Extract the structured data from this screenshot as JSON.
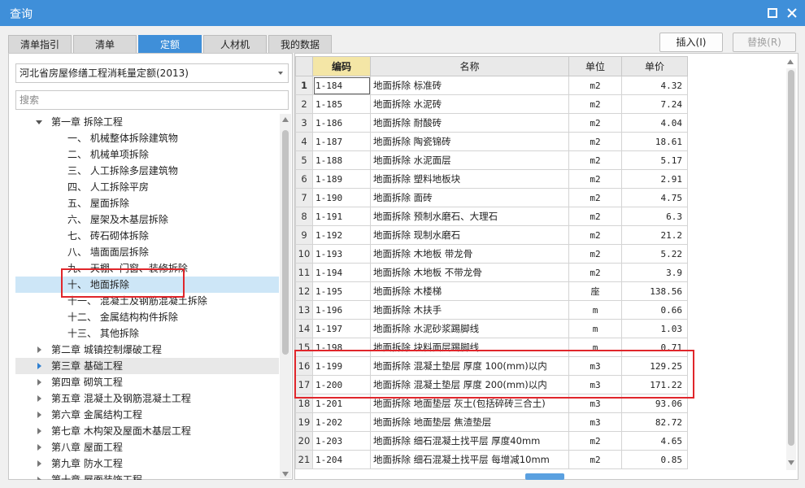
{
  "window": {
    "title": "查询"
  },
  "tabs": [
    {
      "label": "清单指引",
      "active": false
    },
    {
      "label": "清单",
      "active": false
    },
    {
      "label": "定额",
      "active": true
    },
    {
      "label": "人材机",
      "active": false
    },
    {
      "label": "我的数据",
      "active": false
    }
  ],
  "actions": {
    "insert_label": "插入(I)",
    "replace_label": "替换(R)"
  },
  "left": {
    "quota_db": "河北省房屋修缮工程消耗量定额(2013)",
    "search_placeholder": "搜索",
    "tree": [
      {
        "label": "第一章 拆除工程",
        "level": 1,
        "toggle": "down",
        "state": ""
      },
      {
        "label": "一、 机械整体拆除建筑物",
        "level": 2,
        "toggle": "",
        "state": ""
      },
      {
        "label": "二、 机械单项拆除",
        "level": 2,
        "toggle": "",
        "state": ""
      },
      {
        "label": "三、 人工拆除多层建筑物",
        "level": 2,
        "toggle": "",
        "state": ""
      },
      {
        "label": "四、 人工拆除平房",
        "level": 2,
        "toggle": "",
        "state": ""
      },
      {
        "label": "五、 屋面拆除",
        "level": 2,
        "toggle": "",
        "state": ""
      },
      {
        "label": "六、 屋架及木基层拆除",
        "level": 2,
        "toggle": "",
        "state": ""
      },
      {
        "label": "七、 砖石砌体拆除",
        "level": 2,
        "toggle": "",
        "state": ""
      },
      {
        "label": "八、 墙面面层拆除",
        "level": 2,
        "toggle": "",
        "state": ""
      },
      {
        "label": "九、 天棚、门窗、装修拆除",
        "level": 2,
        "toggle": "",
        "state": ""
      },
      {
        "label": "十、 地面拆除",
        "level": 2,
        "toggle": "",
        "state": "selected"
      },
      {
        "label": "十一、 混凝土及钢筋混凝土拆除",
        "level": 2,
        "toggle": "",
        "state": ""
      },
      {
        "label": "十二、 金属结构构件拆除",
        "level": 2,
        "toggle": "",
        "state": ""
      },
      {
        "label": "十三、 其他拆除",
        "level": 2,
        "toggle": "",
        "state": ""
      },
      {
        "label": "第二章 城镇控制爆破工程",
        "level": 1,
        "toggle": "right",
        "state": ""
      },
      {
        "label": "第三章 基础工程",
        "level": 1,
        "toggle": "right-blue",
        "state": "hover"
      },
      {
        "label": "第四章 砌筑工程",
        "level": 1,
        "toggle": "right",
        "state": ""
      },
      {
        "label": "第五章 混凝土及钢筋混凝土工程",
        "level": 1,
        "toggle": "right",
        "state": ""
      },
      {
        "label": "第六章 金属结构工程",
        "level": 1,
        "toggle": "right",
        "state": ""
      },
      {
        "label": "第七章 木构架及屋面木基层工程",
        "level": 1,
        "toggle": "right",
        "state": ""
      },
      {
        "label": "第八章 屋面工程",
        "level": 1,
        "toggle": "right",
        "state": ""
      },
      {
        "label": "第九章 防水工程",
        "level": 1,
        "toggle": "right",
        "state": ""
      },
      {
        "label": "第十章 屋面装饰工程",
        "level": 1,
        "toggle": "right",
        "state": ""
      }
    ]
  },
  "grid": {
    "headers": {
      "code": "编码",
      "name": "名称",
      "unit": "单位",
      "price": "单价"
    },
    "rows": [
      {
        "num": "1",
        "code": "1-184",
        "name": "地面拆除 标准砖",
        "unit": "m2",
        "price": "4.32"
      },
      {
        "num": "2",
        "code": "1-185",
        "name": "地面拆除 水泥砖",
        "unit": "m2",
        "price": "7.24"
      },
      {
        "num": "3",
        "code": "1-186",
        "name": "地面拆除 耐酸砖",
        "unit": "m2",
        "price": "4.04"
      },
      {
        "num": "4",
        "code": "1-187",
        "name": "地面拆除 陶瓷锦砖",
        "unit": "m2",
        "price": "18.61"
      },
      {
        "num": "5",
        "code": "1-188",
        "name": "地面拆除 水泥面层",
        "unit": "m2",
        "price": "5.17"
      },
      {
        "num": "6",
        "code": "1-189",
        "name": "地面拆除 塑料地板块",
        "unit": "m2",
        "price": "2.91"
      },
      {
        "num": "7",
        "code": "1-190",
        "name": "地面拆除 面砖",
        "unit": "m2",
        "price": "4.75"
      },
      {
        "num": "8",
        "code": "1-191",
        "name": "地面拆除 预制水磨石、大理石",
        "unit": "m2",
        "price": "6.3"
      },
      {
        "num": "9",
        "code": "1-192",
        "name": "地面拆除 现制水磨石",
        "unit": "m2",
        "price": "21.2"
      },
      {
        "num": "10",
        "code": "1-193",
        "name": "地面拆除 木地板 带龙骨",
        "unit": "m2",
        "price": "5.22"
      },
      {
        "num": "11",
        "code": "1-194",
        "name": "地面拆除 木地板 不带龙骨",
        "unit": "m2",
        "price": "3.9"
      },
      {
        "num": "12",
        "code": "1-195",
        "name": "地面拆除 木楼梯",
        "unit": "座",
        "price": "138.56"
      },
      {
        "num": "13",
        "code": "1-196",
        "name": "地面拆除 木扶手",
        "unit": "m",
        "price": "0.66"
      },
      {
        "num": "14",
        "code": "1-197",
        "name": "地面拆除 水泥砂浆踢脚线",
        "unit": "m",
        "price": "1.03"
      },
      {
        "num": "15",
        "code": "1-198",
        "name": "地面拆除 块料面层踢脚线",
        "unit": "m",
        "price": "0.71"
      },
      {
        "num": "16",
        "code": "1-199",
        "name": "地面拆除 混凝土垫层 厚度 100(mm)以内",
        "unit": "m3",
        "price": "129.25"
      },
      {
        "num": "17",
        "code": "1-200",
        "name": "地面拆除 混凝土垫层 厚度 200(mm)以内",
        "unit": "m3",
        "price": "171.22"
      },
      {
        "num": "18",
        "code": "1-201",
        "name": "地面拆除 地面垫层 灰土(包括碎砖三合土)",
        "unit": "m3",
        "price": "93.06"
      },
      {
        "num": "19",
        "code": "1-202",
        "name": "地面拆除 地面垫层 焦渣垫层",
        "unit": "m3",
        "price": "82.72"
      },
      {
        "num": "20",
        "code": "1-203",
        "name": "地面拆除 细石混凝土找平层 厚度40mm",
        "unit": "m2",
        "price": "4.65"
      },
      {
        "num": "21",
        "code": "1-204",
        "name": "地面拆除 细石混凝土找平层 每增减10mm",
        "unit": "m2",
        "price": "0.85"
      }
    ]
  }
}
